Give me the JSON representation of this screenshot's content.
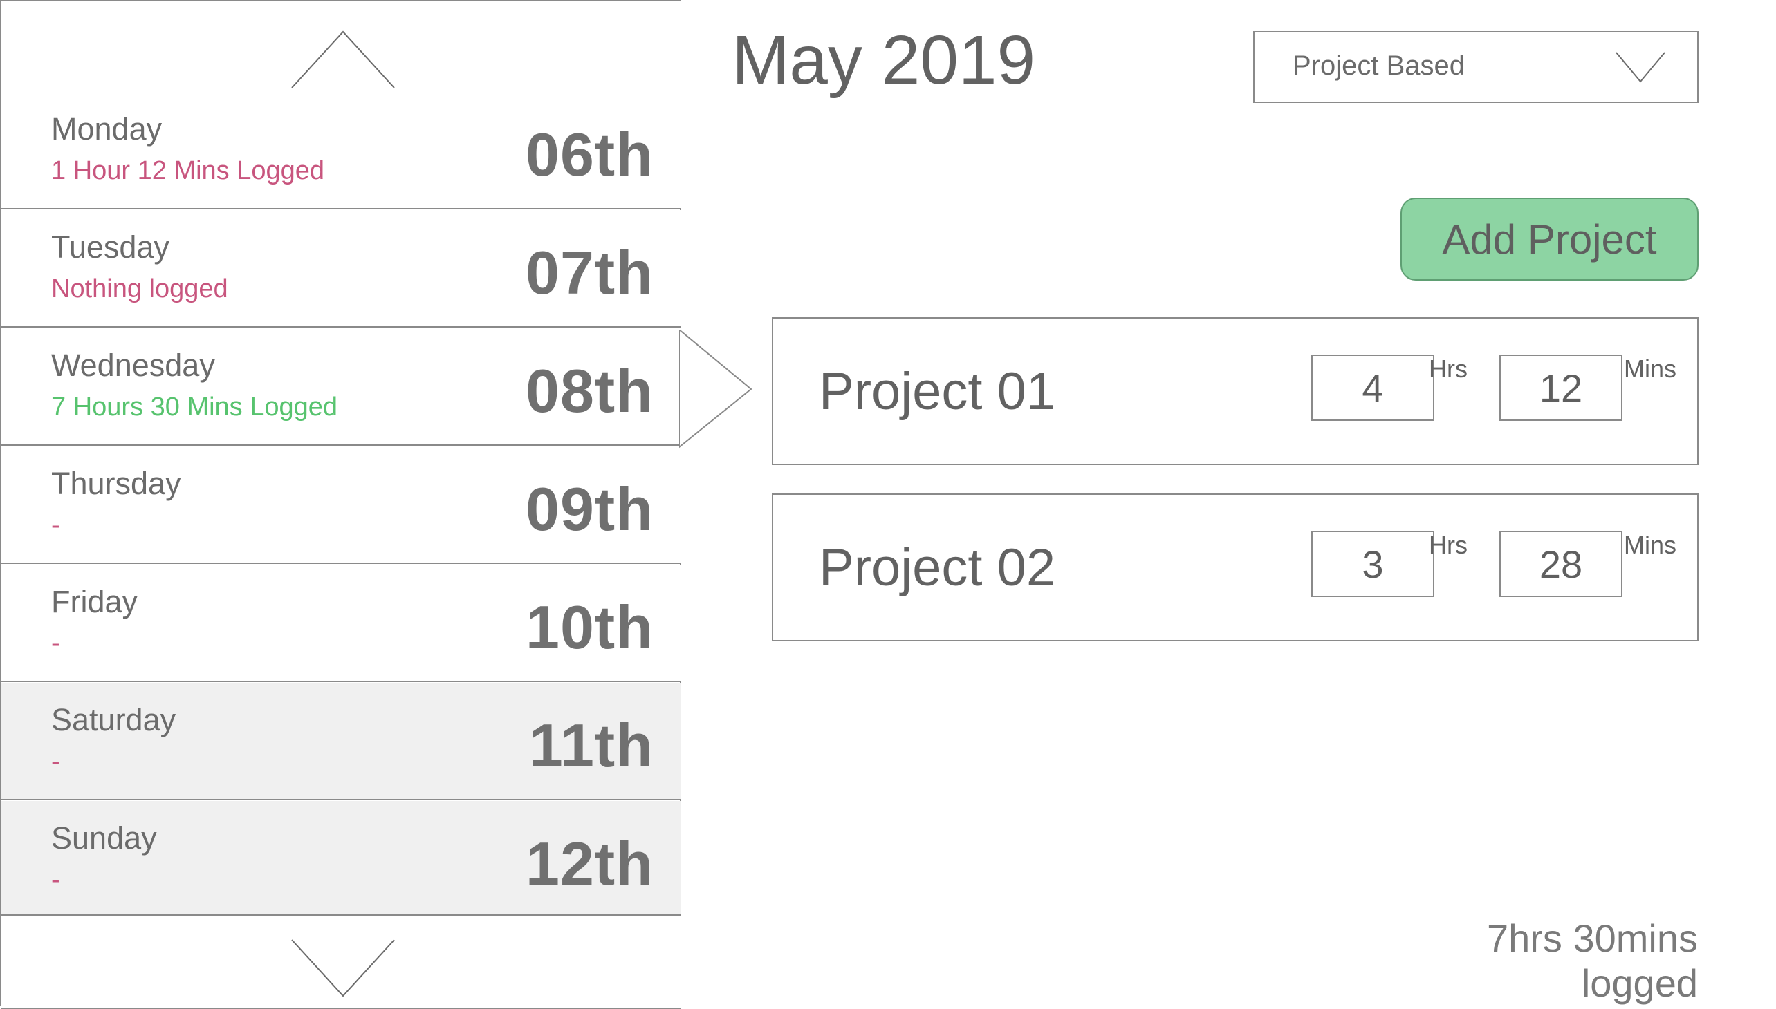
{
  "header": {
    "month_title": "May 2019",
    "mode_select_value": "Project Based",
    "add_project_label": "Add Project"
  },
  "days": [
    {
      "name": "Monday",
      "status": "1 Hour 12 Mins Logged",
      "date": "06th",
      "status_color": "#c8557e",
      "weekend": false
    },
    {
      "name": "Tuesday",
      "status": "Nothing logged",
      "date": "07th",
      "status_color": "#c8557e",
      "weekend": false
    },
    {
      "name": "Wednesday",
      "status": "7 Hours 30 Mins Logged",
      "date": "08th",
      "status_color": "#57c36e",
      "weekend": false,
      "selected": true
    },
    {
      "name": "Thursday",
      "status": "-",
      "date": "09th",
      "status_color": "#c8557e",
      "weekend": false
    },
    {
      "name": "Friday",
      "status": "-",
      "date": "10th",
      "status_color": "#c8557e",
      "weekend": false
    },
    {
      "name": "Saturday",
      "status": "-",
      "date": "11th",
      "status_color": "#c8557e",
      "weekend": true
    },
    {
      "name": "Sunday",
      "status": "-",
      "date": "12th",
      "status_color": "#c8557e",
      "weekend": true
    }
  ],
  "projects": [
    {
      "name": "Project 01",
      "hours": "4",
      "hours_label": "Hrs",
      "mins": "12",
      "mins_label": "Mins"
    },
    {
      "name": "Project 02",
      "hours": "3",
      "hours_label": "Hrs",
      "mins": "28",
      "mins_label": "Mins"
    }
  ],
  "footer": {
    "total_logged": "7hrs 30mins logged"
  },
  "colors": {
    "accent_green": "#8dd4a3",
    "logged_pink": "#c8557e",
    "logged_green": "#57c36e",
    "weekend_bg": "#f0f0f0"
  },
  "icons": {
    "scroll_up": "chevron-up-icon",
    "scroll_down": "chevron-down-icon",
    "select_dropdown": "chevron-down-icon",
    "selected_pointer": "triangle-right-icon"
  }
}
